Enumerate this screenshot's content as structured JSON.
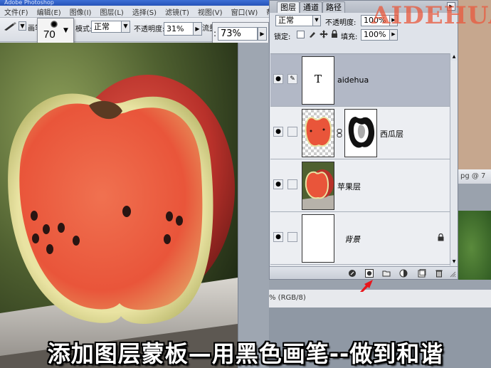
{
  "app": {
    "title": "Adobe Photoshop",
    "menu": [
      "文件(F)",
      "编辑(E)",
      "图像(I)",
      "图层(L)",
      "选择(S)",
      "滤镜(T)",
      "视图(V)",
      "窗口(W)",
      "帮助(H)"
    ]
  },
  "options_bar": {
    "brush_label": "画笔",
    "brush_size": "70",
    "mode_label": "模式:",
    "mode_value": "正常",
    "opacity_label": "不透明度:",
    "opacity_value": "31%",
    "flow_label": "流量",
    "flow_value": "73%"
  },
  "layers_panel": {
    "tabs": [
      "图层",
      "通道",
      "路径"
    ],
    "blend_mode": "正常",
    "opacity_label": "不透明度:",
    "opacity_value": "100%",
    "lock_label": "锁定:",
    "fill_label": "填充:",
    "fill_value": "100%",
    "layers": [
      {
        "name": "aidehua",
        "thumb_text": "T",
        "selected": true
      },
      {
        "name": "西瓜层",
        "selected": false
      },
      {
        "name": "苹果层",
        "selected": false
      },
      {
        "name": "背景",
        "selected": false
      }
    ]
  },
  "doc_window": {
    "title": "pg @ 7"
  },
  "status_bar": {
    "text": "% (RGB/8)"
  },
  "watermark": "AIDEHUA",
  "caption": "添加图层蒙板—用黑色画笔--做到和谐",
  "colors": {
    "selected_layer": "#b2b8c6",
    "watermark": "#e8583c",
    "arrow": "#e8161b",
    "watermelon_flesh": "#e9553a"
  }
}
